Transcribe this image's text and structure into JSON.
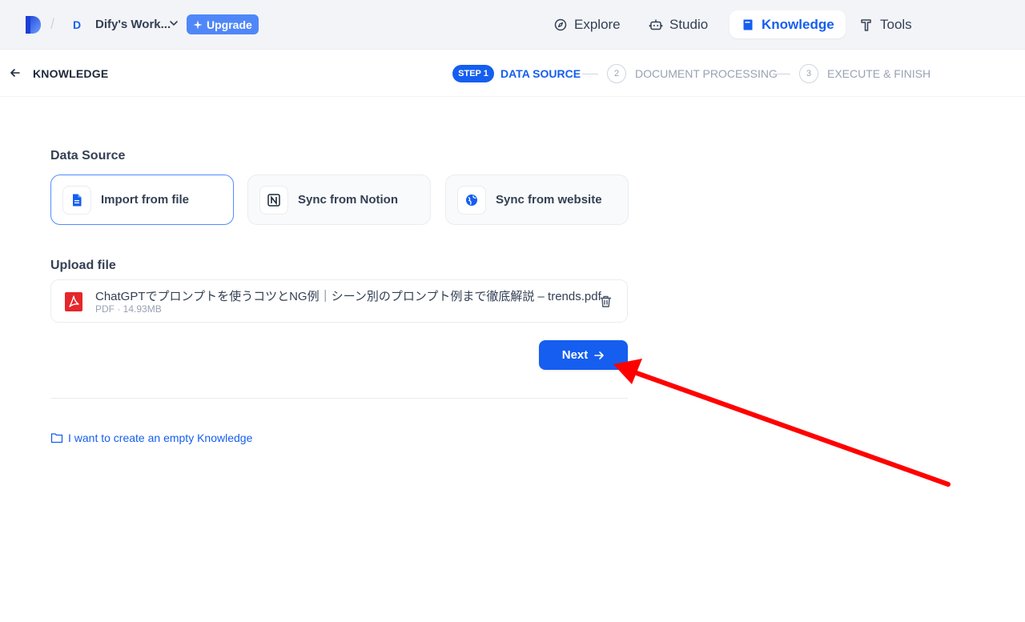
{
  "topbar": {
    "workspace_initial": "D",
    "workspace_name": "Dify's Work...",
    "upgrade_label": "Upgrade",
    "nav": [
      {
        "label": "Explore",
        "icon": "compass-icon",
        "active": false
      },
      {
        "label": "Studio",
        "icon": "robot-icon",
        "active": false
      },
      {
        "label": "Knowledge",
        "icon": "book-icon",
        "active": true
      },
      {
        "label": "Tools",
        "icon": "hammer-icon",
        "active": false
      }
    ]
  },
  "stepbar": {
    "back_label": "KNOWLEDGE",
    "steps": [
      {
        "badge": "STEP 1",
        "label": "DATA SOURCE",
        "active": true
      },
      {
        "badge": "2",
        "label": "DOCUMENT PROCESSING",
        "active": false
      },
      {
        "badge": "3",
        "label": "EXECUTE & FINISH",
        "active": false
      }
    ]
  },
  "data_source": {
    "title": "Data Source",
    "options": [
      {
        "label": "Import from file",
        "icon": "file-icon",
        "active": true
      },
      {
        "label": "Sync from Notion",
        "icon": "notion-icon",
        "active": false
      },
      {
        "label": "Sync from website",
        "icon": "globe-icon",
        "active": false
      }
    ]
  },
  "upload": {
    "title": "Upload file",
    "file": {
      "name": "ChatGPTでプロンプトを使うコツとNG例｜シーン別のプロンプト例まで徹底解説 – trends.pdf",
      "meta": "PDF · 14.93MB"
    }
  },
  "actions": {
    "next_label": "Next",
    "empty_knowledge_label": "I want to create an empty Knowledge"
  },
  "colors": {
    "accent": "#155eef",
    "upgrade": "#5087f8",
    "annotation": "#ff0000"
  }
}
